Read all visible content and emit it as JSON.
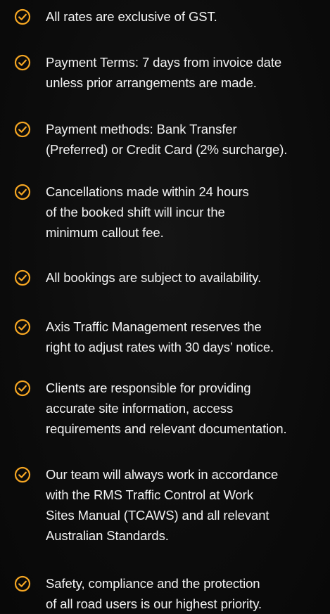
{
  "accent_color": "#f5a623",
  "icon": "check-circle-icon",
  "terms": [
    {
      "lines": [
        "All rates are exclusive of GST."
      ]
    },
    {
      "lines": [
        "Payment Terms: 7 days from invoice date",
        "unless prior arrangements are made."
      ]
    },
    {
      "lines": [
        "Payment methods: Bank Transfer",
        "(Preferred) or Credit Card (2% surcharge)."
      ]
    },
    {
      "lines": [
        "Cancellations made within 24 hours",
        "of the booked shift will incur the",
        "minimum callout fee."
      ]
    },
    {
      "lines": [
        "All bookings are subject to availability."
      ]
    },
    {
      "lines": [
        "Axis Traffic Management reserves the",
        "right to adjust rates with 30 days’ notice."
      ]
    },
    {
      "lines": [
        "Clients are responsible for providing",
        "accurate site information, access",
        "requirements and relevant documentation."
      ]
    },
    {
      "lines": [
        "Our team will always work in accordance",
        "with the RMS Traffic Control at Work",
        "Sites Manual (TCAWS) and all relevant",
        "Australian Standards."
      ]
    },
    {
      "lines": [
        "Safety, compliance and the protection",
        "of all road users is our highest priority."
      ]
    }
  ]
}
